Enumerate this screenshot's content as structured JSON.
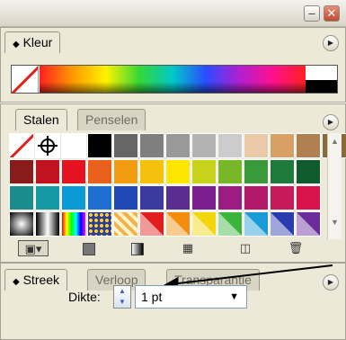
{
  "kleur_panel": {
    "tab_label": "Kleur",
    "menu_icon": "panel-menu-icon"
  },
  "window": {
    "minimize_glyph": "–",
    "close_glyph": "✕"
  },
  "stalen_panel": {
    "tabs": [
      "Stalen",
      "Penselen"
    ],
    "active_tab": "Stalen",
    "swatch_rows": [
      [
        "none",
        "registration",
        "#ffffff",
        "#000000",
        "#666666",
        "#7f7f7f",
        "#999999",
        "#b3b3b3",
        "#cccccc",
        "#e9c9a8",
        "#d9a066",
        "#b08050",
        "#8a6a3a"
      ],
      [
        "#8b1a1a",
        "#c1121f",
        "#e5121f",
        "#e8601c",
        "#f39c12",
        "#f4c20d",
        "#ffe600",
        "#c7d31a",
        "#77b829",
        "#3a9a3a",
        "#1e7a3a",
        "#0f5b2e"
      ],
      [
        "#1a8c8c",
        "#159aa5",
        "#0a9ad6",
        "#1e6fd0",
        "#1e48b4",
        "#3a3a9e",
        "#5a2d91",
        "#7b1e8f",
        "#9b1d81",
        "#b2196a",
        "#c61a5a",
        "#d8124a"
      ],
      [
        "gradient-radial",
        "gradient-linear",
        "gradient-spectrum",
        "pattern-dots",
        "pattern-tiles",
        "#e11d1d",
        "#f28c0a",
        "#f2d60a",
        "#3cb43c",
        "#1a9ad6",
        "#2a3bb0",
        "#6a2b9b"
      ]
    ],
    "bottom_icons": [
      "swatch-kinds-icon",
      "show-color-swatches-icon",
      "show-gradient-swatches-icon",
      "show-pattern-swatches-icon",
      "new-swatch-icon",
      "delete-swatch-icon"
    ]
  },
  "streek_panel": {
    "tabs": [
      "Streek",
      "Verloop",
      "Transparantie"
    ],
    "active_tab": "Streek",
    "dikte_label": "Dikte:",
    "dikte_value": "1 pt"
  }
}
